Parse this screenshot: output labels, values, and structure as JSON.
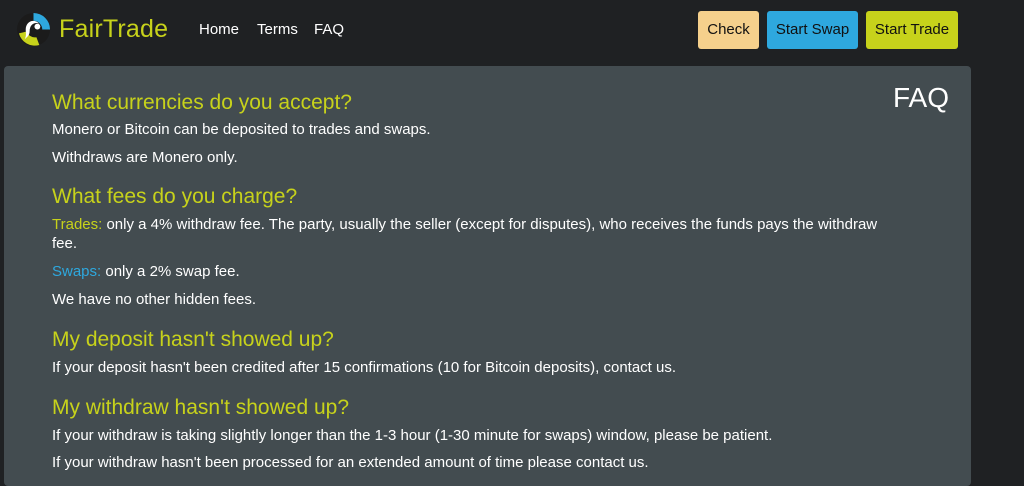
{
  "navbar": {
    "brand": "FairTrade",
    "links": [
      "Home",
      "Terms",
      "FAQ"
    ],
    "buttons": {
      "check": "Check",
      "start_swap": "Start Swap",
      "start_trade": "Start Trade"
    },
    "logo_icon": "fairtrade-logo-icon"
  },
  "colors": {
    "accent": "#c7d21b",
    "swap": "#2ea8de",
    "check_button": "#f5d08c",
    "panel": "#434c50",
    "background": "#1f2123"
  },
  "faq": {
    "title": "FAQ",
    "q1": "What currencies do you accept?",
    "a1_1": "Monero or Bitcoin can be deposited to trades and swaps.",
    "a1_2": "Withdraws are Monero only.",
    "q2": "What fees do you charge?",
    "a2_trades_label": "Trades:",
    "a2_trades_text": " only a 4% withdraw fee. The party, usually the seller (except for disputes), who receives the funds pays the withdraw fee.",
    "a2_swaps_label": "Swaps:",
    "a2_swaps_text": " only a 2% swap fee.",
    "a2_3": "We have no other hidden fees.",
    "q3": "My deposit hasn't showed up?",
    "a3_1": "If your deposit hasn't been credited after 15 confirmations (10 for Bitcoin deposits), contact us.",
    "q4": "My withdraw hasn't showed up?",
    "a4_1": "If your withdraw is taking slightly longer than the 1-3 hour (1-30 minute for swaps) window, please be patient.",
    "a4_2": "If your withdraw hasn't been processed for an extended amount of time please contact us."
  }
}
